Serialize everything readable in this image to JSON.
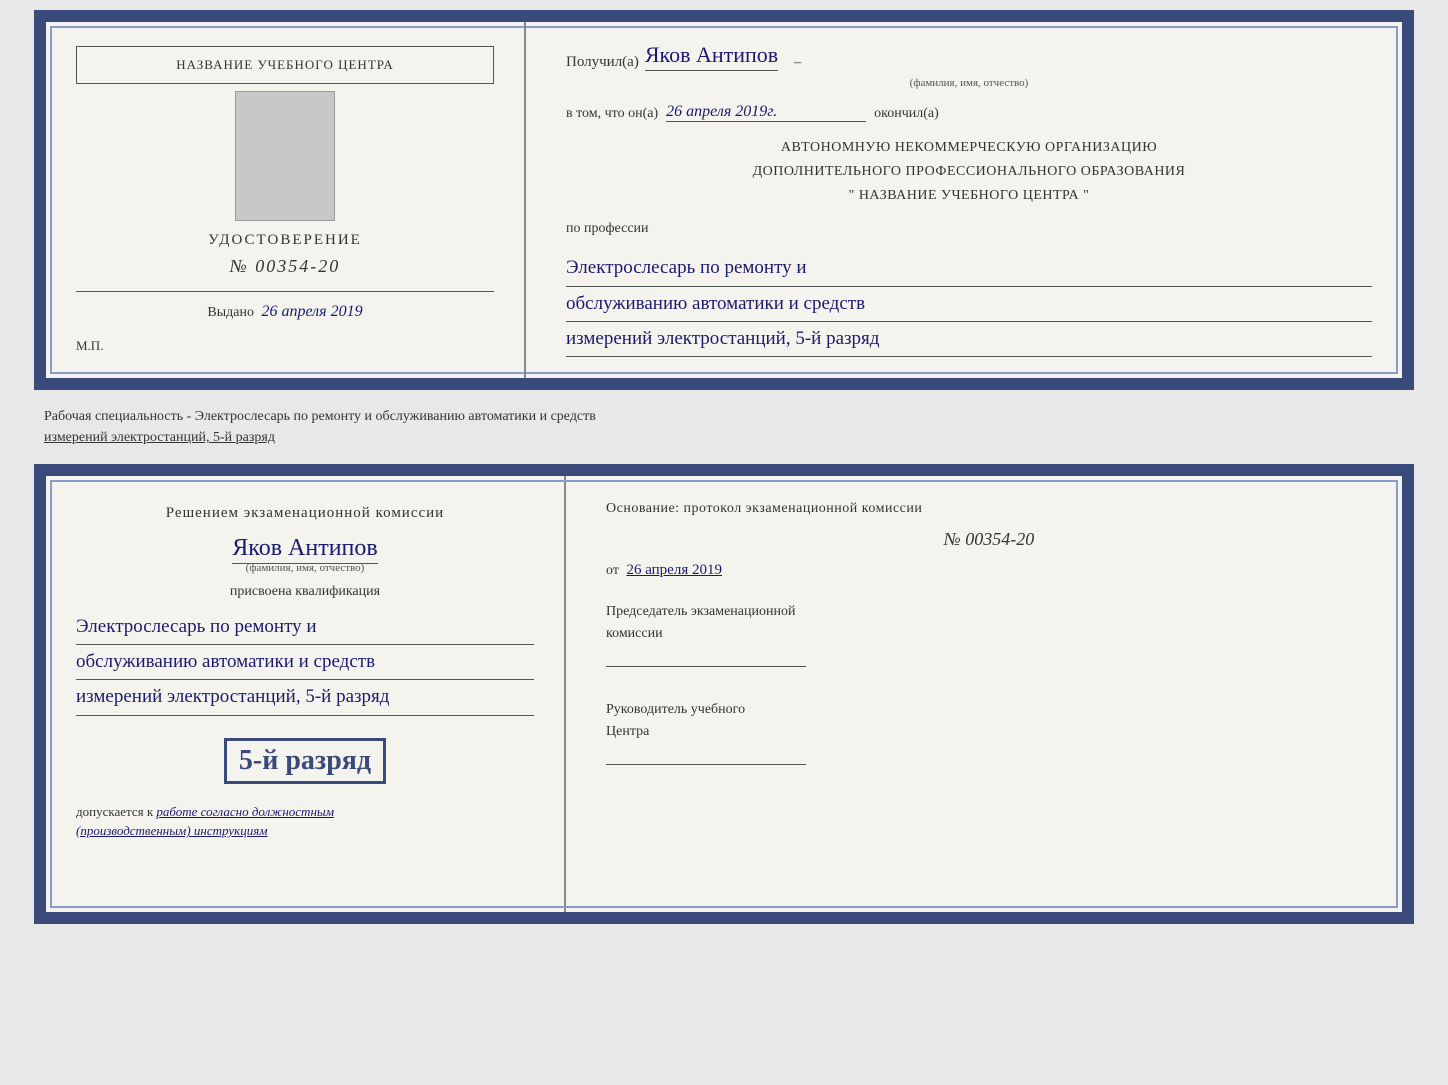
{
  "topCert": {
    "left": {
      "schoolNameLabel": "НАЗВАНИЕ УЧЕБНОГО ЦЕНТРА",
      "titleLine1": "УДОСТОВЕРЕНИЕ",
      "numberLabel": "№ 00354-20",
      "issuedLabel": "Выдано",
      "issuedDate": "26 апреля 2019",
      "mpLabel": "М.П."
    },
    "right": {
      "receivedPrefix": "Получил(а)",
      "recipientName": "Яков Антипов",
      "recipientSubtext": "(фамилия, имя, отчество)",
      "factPrefix": "в том, что он(а)",
      "factDate": "26 апреля 2019г.",
      "finishedLabel": "окончил(а)",
      "orgLine1": "АВТОНОМНУЮ НЕКОММЕРЧЕСКУЮ ОРГАНИЗАЦИЮ",
      "orgLine2": "ДОПОЛНИТЕЛЬНОГО ПРОФЕССИОНАЛЬНОГО ОБРАЗОВАНИЯ",
      "orgLine3": "\"  НАЗВАНИЕ УЧЕБНОГО ЦЕНТРА  \"",
      "professionLabel": "по профессии",
      "professionLine1": "Электрослесарь по ремонту и",
      "professionLine2": "обслуживанию автоматики и средств",
      "professionLine3": "измерений электростанций, 5-й разряд"
    }
  },
  "infoText": {
    "line1": "Рабочая специальность - Электрослесарь по ремонту и обслуживанию автоматики и средств",
    "line2": "измерений электростанций, 5-й разряд"
  },
  "bottomCert": {
    "left": {
      "decisionTitle": "Решением экзаменационной комиссии",
      "recipientName": "Яков Антипов",
      "recipientSubtext": "(фамилия, имя, отчество)",
      "assignedLabel": "присвоена квалификация",
      "profLine1": "Электрослесарь по ремонту и",
      "profLine2": "обслуживанию автоматики и средств",
      "profLine3": "измерений электростанций, 5-й разряд",
      "rankHighlight": "5-й разряд",
      "допускаетсяLabel": "допускается к",
      "допускаетсяText": "работе согласно должностным",
      "инструкцииText": "(производственным) инструкциям"
    },
    "right": {
      "basisLabel": "Основание: протокол экзаменационной  комиссии",
      "protocolNumber": "№  00354-20",
      "fromLabel": "от",
      "fromDate": "26 апреля 2019",
      "chairmanLabel": "Председатель экзаменационной",
      "chairmanLabel2": "комиссии",
      "directorLabel": "Руководитель учебного",
      "directorLabel2": "Центра"
    }
  }
}
